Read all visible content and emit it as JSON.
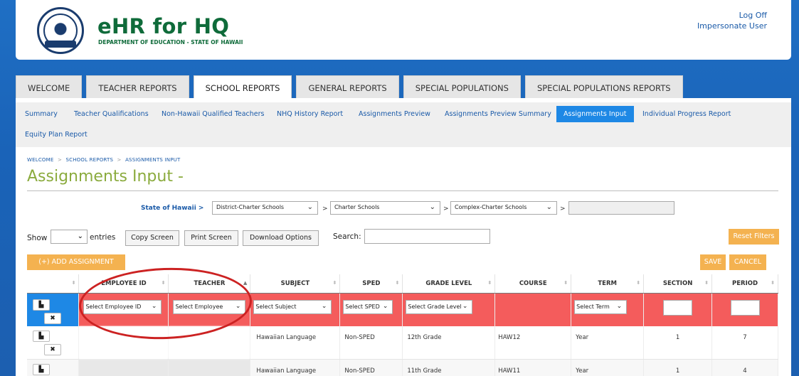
{
  "header": {
    "app_title": "eHR for HQ",
    "app_subtitle": "DEPARTMENT OF EDUCATION - STATE OF HAWAII",
    "log_off": "Log Off",
    "impersonate": "Impersonate User"
  },
  "tabs": [
    {
      "label": "WELCOME"
    },
    {
      "label": "TEACHER REPORTS"
    },
    {
      "label": "SCHOOL REPORTS",
      "active": true
    },
    {
      "label": "GENERAL REPORTS"
    },
    {
      "label": "SPECIAL POPULATIONS"
    },
    {
      "label": "SPECIAL POPULATIONS REPORTS"
    }
  ],
  "subnav": [
    {
      "label": "Summary"
    },
    {
      "label": "Teacher Qualifications"
    },
    {
      "label": "Non-Hawaii Qualified Teachers"
    },
    {
      "label": "NHQ History Report"
    },
    {
      "label": "Assignments Preview"
    },
    {
      "label": "Assignments Preview Summary"
    },
    {
      "label": "Assignments Input",
      "active": true
    },
    {
      "label": "Individual Progress Report"
    },
    {
      "label": "Equity Plan Report"
    }
  ],
  "breadcrumb": {
    "items": [
      "WELCOME",
      "SCHOOL REPORTS",
      "ASSIGNMENTS INPUT"
    ],
    "sep": ">"
  },
  "page_title": "Assignments Input -",
  "filters": {
    "state_label": "State of Hawaii >",
    "district": "District-Charter Schools",
    "charter": "Charter Schools",
    "complex": "Complex-Charter Schools",
    "sep": ">"
  },
  "controls": {
    "show": "Show",
    "entries": "entries",
    "copy": "Copy Screen",
    "print": "Print Screen",
    "download": "Download Options",
    "search": "Search:",
    "reset": "Reset Filters",
    "add": "(+) ADD ASSIGNMENT",
    "save": "SAVE",
    "cancel": "CANCEL"
  },
  "table": {
    "headers": [
      "",
      "EMPLOYEE ID",
      "TEACHER",
      "SUBJECT",
      "SPED",
      "GRADE LEVEL",
      "COURSE",
      "TERM",
      "SECTION",
      "PERIOD"
    ],
    "input_row": {
      "employee": "Select Employee ID",
      "teacher": "Select Employee",
      "subject": "Select Subject",
      "sped": "Select SPED",
      "grade": "Select Grade Level",
      "term": "Select Term"
    },
    "rows": [
      {
        "employee_id": "",
        "teacher": "",
        "subject": "Hawaiian Language",
        "sped": "Non-SPED",
        "grade": "12th Grade",
        "course": "HAW12",
        "term": "Year",
        "section": "1",
        "period": "7"
      },
      {
        "employee_id": "",
        "teacher": "",
        "subject": "Hawaiian Language",
        "sped": "Non-SPED",
        "grade": "11th Grade",
        "course": "HAW11",
        "term": "Year",
        "section": "1",
        "period": "4"
      }
    ]
  },
  "icons": {
    "file": "file-icon",
    "delete": "x-icon",
    "chevron": "chevron-down-icon"
  },
  "colors": {
    "brand_green": "#0f6b3a",
    "title_green": "#8bab3e",
    "active_blue": "#1e88e5",
    "input_row_red": "#f45c5c",
    "orange": "#f4b250"
  }
}
